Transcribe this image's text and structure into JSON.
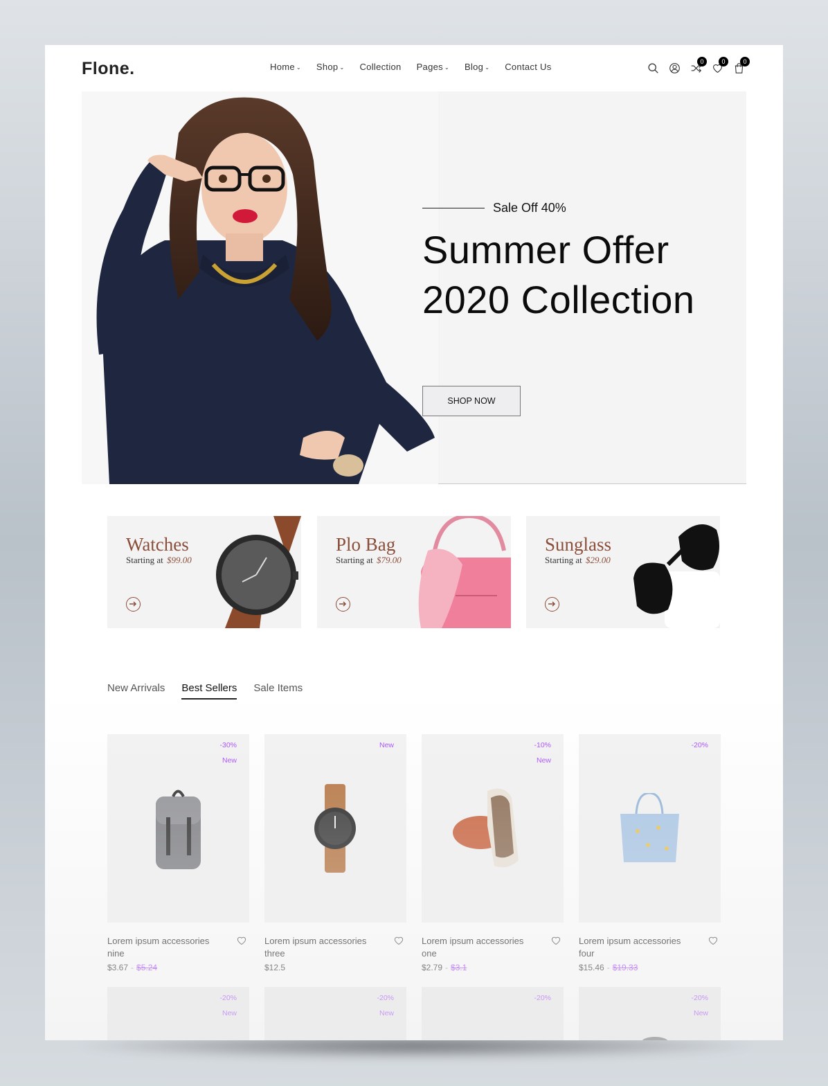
{
  "brand": {
    "logo": "Flone."
  },
  "nav": [
    {
      "label": "Home",
      "chevron": true
    },
    {
      "label": "Shop",
      "chevron": true
    },
    {
      "label": "Collection",
      "chevron": false
    },
    {
      "label": "Pages",
      "chevron": true
    },
    {
      "label": "Blog",
      "chevron": true
    },
    {
      "label": "Contact Us",
      "chevron": false
    }
  ],
  "header_icons": {
    "search": "search-icon",
    "account": "user-icon",
    "compare": {
      "icon": "shuffle-icon",
      "count": "0"
    },
    "wishlist": {
      "icon": "heart-icon",
      "count": "0"
    },
    "cart": {
      "icon": "bag-icon",
      "count": "0"
    }
  },
  "hero": {
    "kicker": "Sale Off 40%",
    "title_line1": "Summer Offer",
    "title_line2": "2020 Collection",
    "button": "SHOP NOW"
  },
  "categories": [
    {
      "title": "Watches",
      "starting": "Starting at",
      "price": "$99.00"
    },
    {
      "title": "Plo Bag",
      "starting": "Starting at",
      "price": "$79.00"
    },
    {
      "title": "Sunglass",
      "starting": "Starting at",
      "price": "$29.00"
    }
  ],
  "tabs": [
    {
      "label": "New Arrivals",
      "active": false
    },
    {
      "label": "Best Sellers",
      "active": true
    },
    {
      "label": "Sale Items",
      "active": false
    }
  ],
  "products": [
    {
      "name": "Lorem ipsum accessories nine",
      "price": "$3.67",
      "old_price": "$5.24",
      "label1": "-30%",
      "label2": "New"
    },
    {
      "name": "Lorem ipsum accessories three",
      "price": "$12.5",
      "old_price": "",
      "label1": "New",
      "label2": ""
    },
    {
      "name": "Lorem ipsum accessories one",
      "price": "$2.79",
      "old_price": "$3.1",
      "label1": "-10%",
      "label2": "New"
    },
    {
      "name": "Lorem ipsum accessories four",
      "price": "$15.46",
      "old_price": "$19.33",
      "label1": "-20%",
      "label2": ""
    }
  ],
  "products_row2": [
    {
      "label1": "-20%",
      "label2": "New"
    },
    {
      "label1": "-20%",
      "label2": "New"
    },
    {
      "label1": "-20%",
      "label2": ""
    },
    {
      "label1": "-20%",
      "label2": "New"
    }
  ],
  "colors": {
    "accent": "#a749ff",
    "category_brown": "#8a4e3a"
  }
}
